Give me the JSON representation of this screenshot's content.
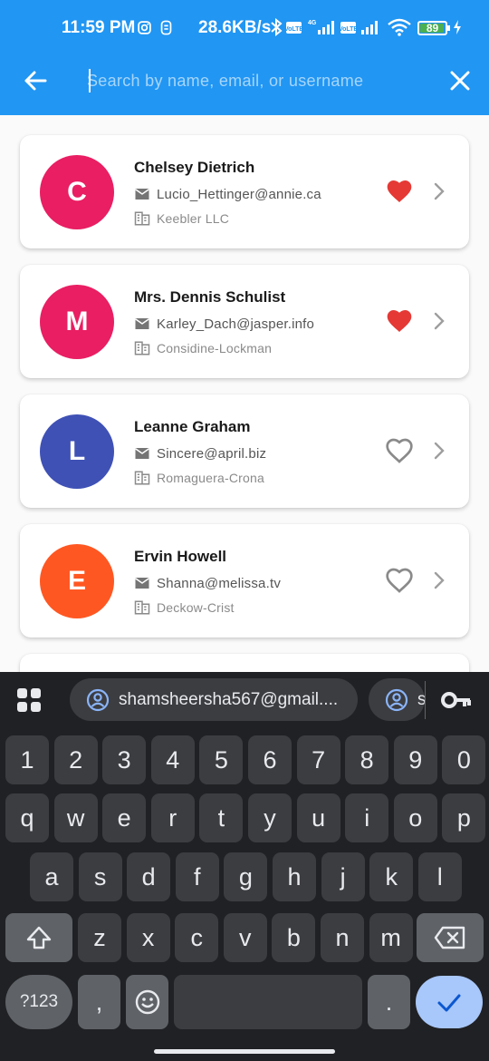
{
  "status_bar": {
    "time": "11:59 PM",
    "net_speed": "28.6KB/s",
    "battery": "89",
    "battery_level": 0.89
  },
  "app_bar": {
    "back_icon": "arrow-left-icon",
    "search_placeholder": "Search by name, email, or username",
    "search_value": "",
    "close_icon": "close-icon",
    "color": "#2196f3"
  },
  "users": [
    {
      "initial": "C",
      "name": "Chelsey Dietrich",
      "email": "Lucio_Hettinger@annie.ca",
      "company": "Keebler LLC",
      "avatar_color": "#e91e63",
      "favorite": true
    },
    {
      "initial": "M",
      "name": "Mrs. Dennis Schulist",
      "email": "Karley_Dach@jasper.info",
      "company": "Considine-Lockman",
      "avatar_color": "#e91e63",
      "favorite": true
    },
    {
      "initial": "L",
      "name": "Leanne Graham",
      "email": "Sincere@april.biz",
      "company": "Romaguera-Crona",
      "avatar_color": "#3f51b5",
      "favorite": false
    },
    {
      "initial": "E",
      "name": "Ervin Howell",
      "email": "Shanna@melissa.tv",
      "company": "Deckow-Crist",
      "avatar_color": "#ff5722",
      "favorite": false
    }
  ],
  "keyboard": {
    "suggestions": [
      "shamsheersha567@gmail....",
      "s"
    ],
    "row_numbers": [
      "1",
      "2",
      "3",
      "4",
      "5",
      "6",
      "7",
      "8",
      "9",
      "0"
    ],
    "row_1": [
      "q",
      "w",
      "e",
      "r",
      "t",
      "y",
      "u",
      "i",
      "o",
      "p"
    ],
    "row_2": [
      "a",
      "s",
      "d",
      "f",
      "g",
      "h",
      "j",
      "k",
      "l"
    ],
    "row_3": [
      "z",
      "x",
      "c",
      "v",
      "b",
      "n",
      "m"
    ],
    "symbols_label": "?123",
    "comma": ",",
    "period": "."
  }
}
